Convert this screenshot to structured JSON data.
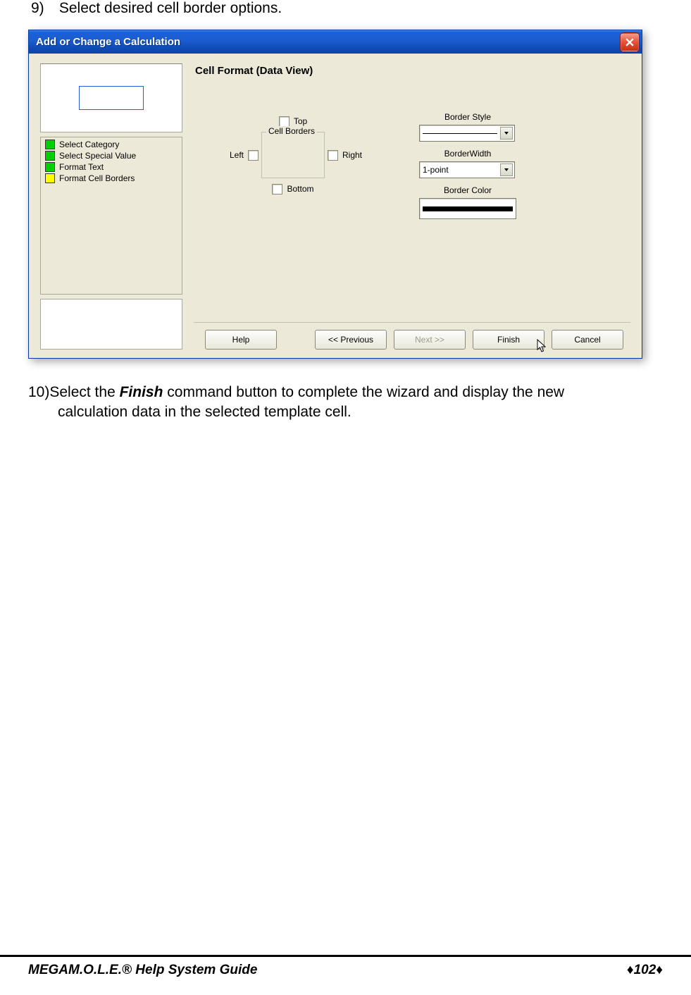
{
  "step9": {
    "num": "9)",
    "text": "Select desired cell border options."
  },
  "dialog": {
    "title": "Add or Change a Calculation",
    "nav": [
      {
        "label": "Select Category",
        "color": "green"
      },
      {
        "label": "Select Special Value",
        "color": "green"
      },
      {
        "label": "Format Text",
        "color": "green"
      },
      {
        "label": "Format Cell Borders",
        "color": "yellow"
      }
    ],
    "heading": "Cell Format (Data View)",
    "borders": {
      "legend": "Cell Borders",
      "top": "Top",
      "left": "Left",
      "right": "Right",
      "bottom": "Bottom"
    },
    "style": {
      "border_style_label": "Border Style",
      "border_width_label": "BorderWidth",
      "border_width_value": "1-point",
      "border_color_label": "Border Color"
    },
    "buttons": {
      "help": "Help",
      "previous": "<< Previous",
      "next": "Next >>",
      "finish": "Finish",
      "cancel": "Cancel"
    }
  },
  "step10": {
    "num": "10)",
    "pre": "Select the ",
    "bold": "Finish",
    "post": " command button to complete the wizard and display the new",
    "line2": "calculation data in the selected template cell."
  },
  "footer": {
    "mega": "MEGA",
    "rest": "M.O.L.E.® Help System Guide",
    "page": "102"
  }
}
